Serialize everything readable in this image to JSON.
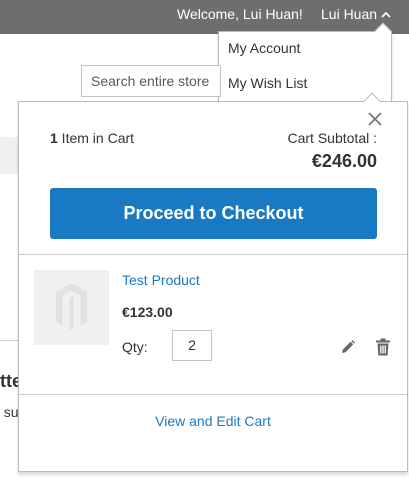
{
  "header": {
    "welcome_text": "Welcome, Lui Huan!",
    "user_name": "Lui Huan",
    "toggle_icon": "chevron-up-icon"
  },
  "account_menu": {
    "items": [
      {
        "label": "My Account"
      },
      {
        "label": "My Wish List"
      }
    ]
  },
  "search": {
    "placeholder": "Search entire store"
  },
  "background": {
    "heading_fragment": "tte",
    "text_fragment": "t su"
  },
  "minicart": {
    "item_count": "1",
    "item_count_suffix": " Item in Cart",
    "subtotal_label": "Cart Subtotal :",
    "subtotal_value": "€246.00",
    "checkout_label": "Proceed to Checkout",
    "close_icon": "close-icon",
    "items": [
      {
        "name": "Test Product",
        "price": "€123.00",
        "qty_label": "Qty:",
        "qty": "2",
        "image_icon": "magento-logo-placeholder",
        "edit_icon": "pencil-icon",
        "delete_icon": "trash-icon"
      }
    ],
    "view_cart_label": "View and Edit Cart"
  },
  "colors": {
    "topbar": "#6e6e6e",
    "primary_button": "#1979c3",
    "link": "#1979c3",
    "image_placeholder": "#f0f0f0"
  }
}
